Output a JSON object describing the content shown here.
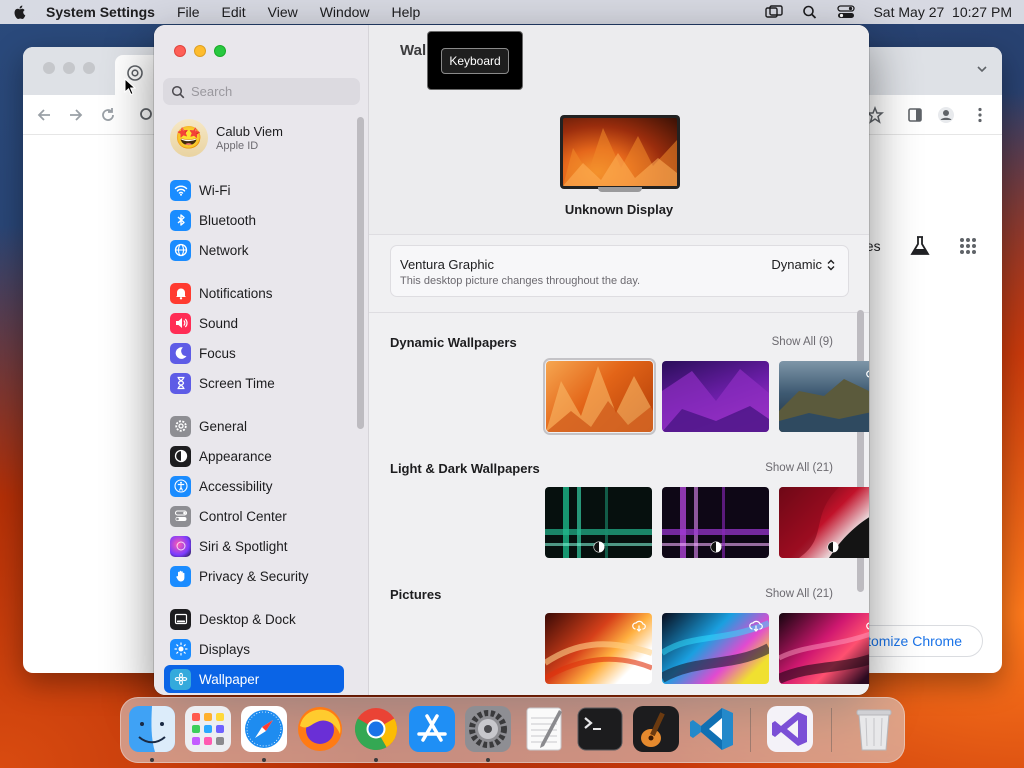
{
  "menubar": {
    "app_name": "System Settings",
    "menus": [
      "File",
      "Edit",
      "View",
      "Window",
      "Help"
    ],
    "clock": "Sat May 27  10:27 PM"
  },
  "chrome": {
    "ntp_images_link": "ges",
    "customize_label": "ustomize Chrome"
  },
  "sidebar": {
    "search_placeholder": "Search",
    "account": {
      "name": "Calub Viem",
      "subtitle": "Apple ID"
    },
    "items": [
      {
        "label": "Wi-Fi",
        "icon": "wifi-icon",
        "color": "#1a8cff"
      },
      {
        "label": "Bluetooth",
        "icon": "bluetooth-icon",
        "color": "#1a8cff"
      },
      {
        "label": "Network",
        "icon": "globe-icon",
        "color": "#1a8cff"
      },
      {
        "label": "Notifications",
        "icon": "bell-icon",
        "color": "#ff3b30"
      },
      {
        "label": "Sound",
        "icon": "speaker-icon",
        "color": "#ff2d55"
      },
      {
        "label": "Focus",
        "icon": "moon-icon",
        "color": "#5e5ce6"
      },
      {
        "label": "Screen Time",
        "icon": "hourglass-icon",
        "color": "#5e5ce6"
      },
      {
        "label": "General",
        "icon": "gear-icon",
        "color": "#8e8e93"
      },
      {
        "label": "Appearance",
        "icon": "appearance-icon",
        "color": "#1d1d1f"
      },
      {
        "label": "Accessibility",
        "icon": "accessibility-icon",
        "color": "#1a8cff"
      },
      {
        "label": "Control Center",
        "icon": "control-center-icon",
        "color": "#8e8e93"
      },
      {
        "label": "Siri & Spotlight",
        "icon": "siri-icon",
        "color": "#b040c0"
      },
      {
        "label": "Privacy & Security",
        "icon": "hand-icon",
        "color": "#1a8cff"
      },
      {
        "label": "Desktop & Dock",
        "icon": "dock-icon",
        "color": "#1d1d1f"
      },
      {
        "label": "Displays",
        "icon": "sun-icon",
        "color": "#1a8cff"
      },
      {
        "label": "Wallpaper",
        "icon": "wallpaper-icon",
        "color": "#34aadc"
      }
    ]
  },
  "main": {
    "title": "Wal",
    "tooltip": "Keyboard",
    "display_name": "Unknown Display",
    "current": {
      "name": "Ventura Graphic",
      "description": "This desktop picture changes throughout the day.",
      "mode": "Dynamic"
    },
    "sections": [
      {
        "title": "Dynamic Wallpapers",
        "show_all": "Show All (9)"
      },
      {
        "title": "Light & Dark Wallpapers",
        "show_all": "Show All (21)"
      },
      {
        "title": "Pictures",
        "show_all": "Show All (21)"
      }
    ]
  },
  "dock": {
    "apps": [
      "finder-icon",
      "launchpad-icon",
      "safari-icon",
      "firefox-icon",
      "chrome-icon",
      "app-store-icon",
      "system-settings-icon",
      "textedit-icon",
      "terminal-icon",
      "garageband-icon",
      "vscode-icon",
      "visual-studio-icon",
      "trash-icon"
    ]
  }
}
